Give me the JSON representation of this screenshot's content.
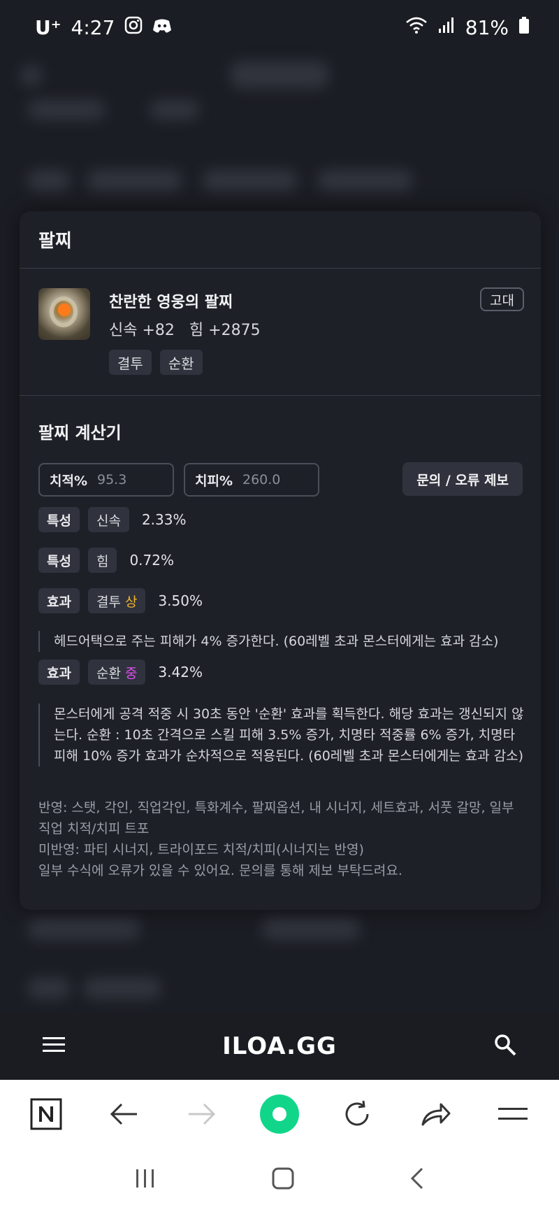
{
  "status_bar": {
    "carrier": "U⁺",
    "time": "4:27",
    "battery": "81%"
  },
  "card": {
    "title": "팔찌",
    "item": {
      "name": "찬란한 영웅의 팔찌",
      "stats": [
        "신속 +82",
        "힘 +2875"
      ],
      "tags": [
        "결투",
        "순환"
      ],
      "grade": "고대"
    }
  },
  "calculator": {
    "title": "팔찌 계산기",
    "crit_rate": {
      "label": "치적%",
      "value": "95.3"
    },
    "crit_damage": {
      "label": "치피%",
      "value": "260.0"
    },
    "report_button": "문의 / 오류 제보",
    "rows": [
      {
        "kind": "특성",
        "name": "신속",
        "level": "",
        "percent": "2.33%"
      },
      {
        "kind": "특성",
        "name": "힘",
        "level": "",
        "percent": "0.72%"
      },
      {
        "kind": "효과",
        "name": "결투",
        "level": "상",
        "percent": "3.50%"
      },
      {
        "kind": "효과",
        "name": "순환",
        "level": "중",
        "percent": "3.42%"
      }
    ],
    "descriptions": [
      "헤드어택으로 주는 피해가 4% 증가한다. (60레벨 초과 몬스터에게는 효과 감소)",
      "몬스터에게 공격 적중 시 30초 동안 '순환' 효과를 획득한다. 해당 효과는 갱신되지 않는다. 순환 : 10초 간격으로 스킬 피해 3.5% 증가, 치명타 적중률 6% 증가, 치명타 피해 10% 증가 효과가 순차적으로 적용된다. (60레벨 초과 몬스터에게는 효과 감소)"
    ],
    "notes": [
      "반영: 스탯, 각인, 직업각인, 특화계수, 팔찌옵션, 내 시너지, 세트효과, 서풋 갈망, 일부 직업 치적/치피 트포",
      "미반영: 파티 시너지, 트라이포드 치적/치피(시너지는 반영)",
      "일부 수식에 오류가 있을 수 있어요. 문의를 통해 제보 부탁드려요."
    ]
  },
  "app_nav": {
    "logo": "ILOA.GG"
  },
  "colors": {
    "level_high": "#f2b62e",
    "level_mid": "#e14df0",
    "browser_home": "#11d68a"
  }
}
